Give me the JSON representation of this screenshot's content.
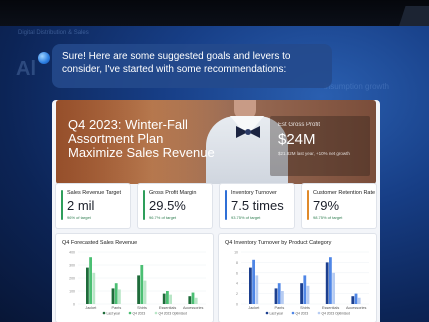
{
  "background": {
    "ghost_title": "Digital Distribution & Sales",
    "ghost_big": "Al",
    "ghost_right": "insumption growth"
  },
  "chat": {
    "message": "Sure! Here are some suggested goals and levers to consider, I've started with some recommendations:",
    "avatar_icon": "copilot-icon"
  },
  "hero": {
    "title_line1": "Q4 2023: Winter-Fall",
    "title_line2": "Assortment Plan",
    "title_line3": "Maximize Sales Revenue",
    "kpi_label": "Est Gross Profit",
    "kpi_value": "$24M",
    "kpi_sub": "$21.82M last year, +10% net growth"
  },
  "kpis": [
    {
      "label": "Sales Revenue Target",
      "value": "2 mil",
      "sub": "96% of target",
      "color": "#2e9e5b"
    },
    {
      "label": "Gross Profit Margin",
      "value": "29.5%",
      "sub": "96.7% of target",
      "color": "#2e9e5b"
    },
    {
      "label": "Inventory Turnover",
      "value": "7.5 times",
      "sub": "93.75% of target",
      "color": "#2f6fd6"
    },
    {
      "label": "Customer Retention Rate",
      "value": "79%",
      "sub": "98.75% of target",
      "color": "#e08a2a"
    }
  ],
  "chart_data": [
    {
      "type": "bar",
      "title": "Q4 Forecasted Sales Revenue",
      "categories": [
        "Jacket",
        "Pants",
        "Shirts",
        "Essentials",
        "Accessories"
      ],
      "series": [
        {
          "name": "Last year",
          "color": "#1e6b3a",
          "values": [
            70,
            30,
            55,
            20,
            15
          ]
        },
        {
          "name": "Q4 2023",
          "color": "#4bbf73",
          "values": [
            90,
            40,
            75,
            25,
            22
          ]
        },
        {
          "name": "Q4 2023 Optimized",
          "color": "#b9e6c7",
          "values": [
            60,
            28,
            45,
            18,
            12
          ]
        }
      ],
      "yticks": [
        "400",
        "300",
        "200",
        "100",
        "0"
      ],
      "ylim": [
        0,
        100
      ]
    },
    {
      "type": "bar",
      "title": "Q4 Inventory Turnover by Product Category",
      "categories": [
        "Jacket",
        "Pants",
        "Shirts",
        "Essentials",
        "Accessories"
      ],
      "series": [
        {
          "name": "Last year",
          "color": "#1c3f8f",
          "values": [
            70,
            30,
            40,
            80,
            15
          ]
        },
        {
          "name": "Q4 2023",
          "color": "#4f86e6",
          "values": [
            85,
            40,
            55,
            90,
            20
          ]
        },
        {
          "name": "Q4 2023 Optimized",
          "color": "#b7ccf2",
          "values": [
            55,
            25,
            35,
            60,
            12
          ]
        }
      ],
      "yticks": [
        "10",
        "8",
        "6",
        "4",
        "2",
        "0"
      ],
      "ylim": [
        0,
        100
      ]
    }
  ]
}
